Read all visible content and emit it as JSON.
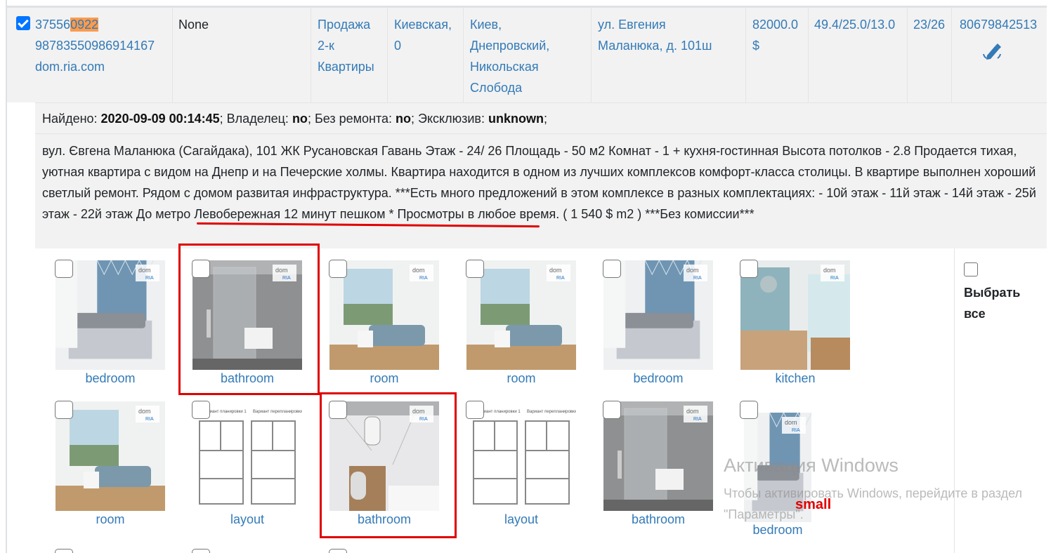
{
  "listing": {
    "id_prefix": "37556",
    "id_highlight": "0922",
    "id_rest": "98783550986914167",
    "source": "dom.ria.com",
    "none_label": "None",
    "deal": [
      "Продажа",
      "2-к",
      "Квартиры"
    ],
    "region": [
      "Киевская,",
      "0"
    ],
    "city": [
      "Киев,",
      "Днепровский,",
      "Никольская",
      "Слобода"
    ],
    "street": [
      "ул. Евгения",
      "Маланюка, д. 101ш"
    ],
    "price": [
      "82000.0",
      "$"
    ],
    "area": "49.4/25.0/13.0",
    "floor": "23/26",
    "phone": "80679842513"
  },
  "found": {
    "found_label": "Найдено: ",
    "found_value": "2020-09-09 00:14:45",
    "owner_label": "; Владелец: ",
    "owner_value": "no",
    "renov_label": "; Без ремонта: ",
    "renov_value": "no",
    "excl_label": "; Эксклюзив: ",
    "excl_value": "unknown",
    "end": ";"
  },
  "description": "вул. Євгена Маланюка (Сагайдака), 101 ЖК Русановская Гавань Этаж - 24/ 26 Площадь - 50 м2 Комнат - 1 + кухня-гостинная Высота потолков - 2.8 Продается тихая, уютная квартира с видом на Днепр и на Печерские холмы. Квартира находится в одном из лучших комплексов комфорт-класса столицы. В квартире выполнен хороший светлый ремонт. Рядом с домом развитая инфраструктура. ***Есть много предложений в этом комплексе в разных комплектациях: - 10й этаж - 11й этаж - 14й этаж - 25й этаж - 22й этаж До метро Левобережная 12 минут пешком * Просмотры в любое время. ( 1 540 $ m2 ) ***Без комиссии***",
  "photos_row1": [
    {
      "label": "bedroom",
      "kind": "bedroom"
    },
    {
      "label": "bathroom",
      "kind": "bathroom"
    },
    {
      "label": "room",
      "kind": "room"
    },
    {
      "label": "room",
      "kind": "room2"
    },
    {
      "label": "bedroom",
      "kind": "bedroom2"
    },
    {
      "label": "kitchen",
      "kind": "kitchen"
    }
  ],
  "photos_row2": [
    {
      "label": "room",
      "kind": "room3"
    },
    {
      "label": "layout",
      "kind": "layout"
    },
    {
      "label": "bathroom",
      "kind": "bathroom2"
    },
    {
      "label": "layout",
      "kind": "layout"
    },
    {
      "label": "bathroom",
      "kind": "bathroom3"
    },
    {
      "label": "bedroom",
      "kind": "bedroom3"
    }
  ],
  "select_all": [
    "Выбрать",
    "все"
  ],
  "watermark": {
    "title": "Активация Windows",
    "text": "Чтобы активировать Windows, перейдите в раздел \"Параметры\"."
  },
  "small_label": "small",
  "logo_text": "dom"
}
